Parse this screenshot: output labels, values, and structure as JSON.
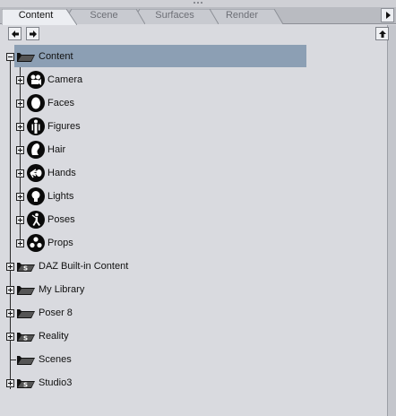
{
  "tabs": [
    {
      "label": "Content",
      "active": true
    },
    {
      "label": "Scene",
      "active": false
    },
    {
      "label": "Surfaces",
      "active": false
    },
    {
      "label": "Render",
      "active": false
    }
  ],
  "toolbar": {
    "back_icon": "arrow-left-icon",
    "forward_icon": "arrow-right-icon",
    "up_icon": "arrow-up-icon",
    "tab_scroll_icon": "triangle-right-icon"
  },
  "tree": {
    "root": {
      "label": "Content",
      "icon": "folder-open-icon",
      "expanded": true,
      "selected": true
    },
    "children": [
      {
        "label": "Camera",
        "icon": "camera-icon"
      },
      {
        "label": "Faces",
        "icon": "face-icon"
      },
      {
        "label": "Figures",
        "icon": "figure-icon"
      },
      {
        "label": "Hair",
        "icon": "hair-icon"
      },
      {
        "label": "Hands",
        "icon": "hand-icon"
      },
      {
        "label": "Lights",
        "icon": "lightbulb-icon"
      },
      {
        "label": "Poses",
        "icon": "pose-icon"
      },
      {
        "label": "Props",
        "icon": "props-icon"
      }
    ],
    "roots": [
      {
        "label": "DAZ Built-in Content",
        "icon": "daz-folder-icon"
      },
      {
        "label": "My Library",
        "icon": "folder-open-icon"
      },
      {
        "label": "Poser 8",
        "icon": "folder-open-icon"
      },
      {
        "label": "Reality",
        "icon": "daz-folder-icon"
      },
      {
        "label": "Scenes",
        "icon": "folder-open-icon"
      },
      {
        "label": "Studio3",
        "icon": "daz-folder-icon"
      }
    ]
  },
  "colors": {
    "selection": "#8c9fb4",
    "background": "#d9dadf",
    "tabbar": "#b9bbc1"
  }
}
